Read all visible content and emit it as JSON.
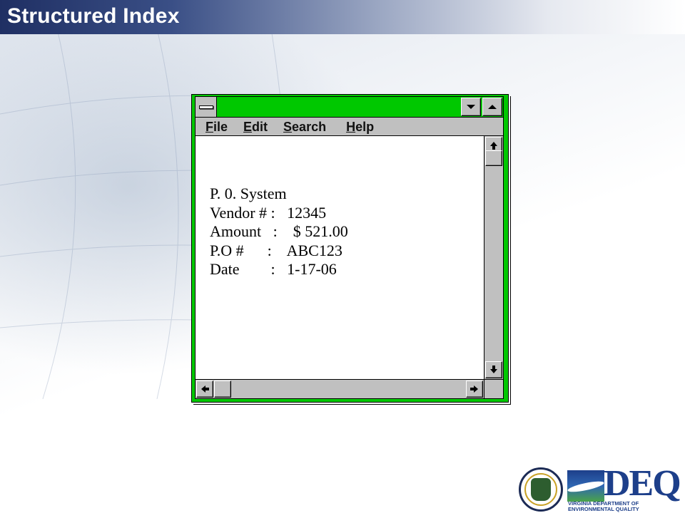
{
  "slide": {
    "title": "Structured Index"
  },
  "window": {
    "menu": [
      "File",
      "Edit",
      "Search",
      "Help"
    ],
    "lines": [
      "P. 0. System",
      "Vendor # :   12345",
      "Amount   :    $ 521.00",
      "P.O #      :    ABC123",
      "Date        :   1-17-06"
    ]
  },
  "logos": {
    "deq_text": "DEQ",
    "deq_sub": "VIRGINIA DEPARTMENT OF\nENVIRONMENTAL QUALITY"
  },
  "colors": {
    "titlebar": "#00c800",
    "chrome": "#c0c0c0",
    "title_band_start": "#1f2f63",
    "deq_blue": "#1d3f8a"
  }
}
